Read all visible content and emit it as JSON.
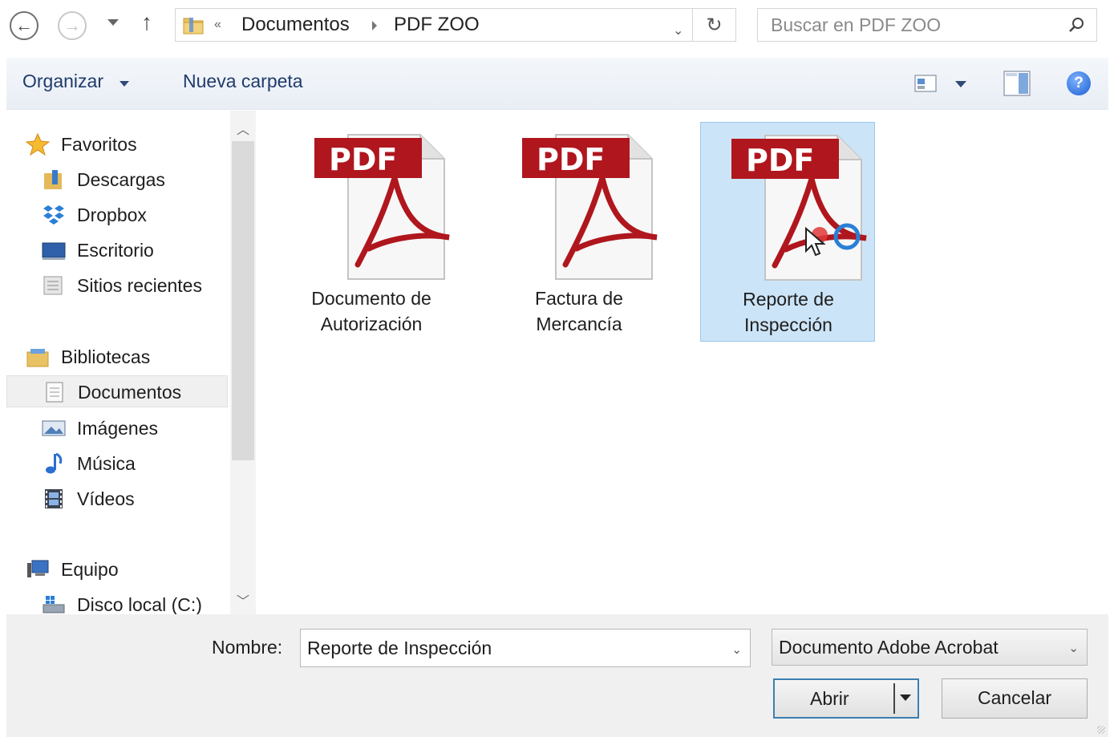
{
  "address": {
    "overflow_symbol": "«",
    "crumbs": [
      "Documentos",
      "PDF ZOO"
    ]
  },
  "search": {
    "placeholder": "Buscar en PDF ZOO"
  },
  "commands": {
    "organize": "Organizar",
    "new_folder": "Nueva carpeta"
  },
  "sidebar": {
    "favorites": {
      "header": "Favoritos",
      "items": [
        "Descargas",
        "Dropbox",
        "Escritorio",
        "Sitios recientes"
      ]
    },
    "libraries": {
      "header": "Bibliotecas",
      "items": [
        "Documentos",
        "Imágenes",
        "Música",
        "Vídeos"
      ],
      "selected": "Documentos"
    },
    "computer": {
      "header": "Equipo",
      "items": [
        "Disco local (C:)"
      ]
    }
  },
  "files": [
    {
      "name_line1": "Documento de",
      "name_line2": "Autorización",
      "badge": "PDF"
    },
    {
      "name_line1": "Factura de",
      "name_line2": "Mercancía",
      "badge": "PDF"
    },
    {
      "name_line1": "Reporte de",
      "name_line2": "Inspección",
      "badge": "PDF",
      "selected": true
    }
  ],
  "footer": {
    "name_label": "Nombre:",
    "name_value": "Reporte de Inspección",
    "file_type": "Documento Adobe Acrobat",
    "open_button": "Abrir",
    "cancel_button": "Cancelar"
  },
  "colors": {
    "selection_bg": "#cce4f7",
    "selection_border": "#99c9ef",
    "pdf_red": "#b0161d",
    "command_text": "#1f3b6b"
  }
}
